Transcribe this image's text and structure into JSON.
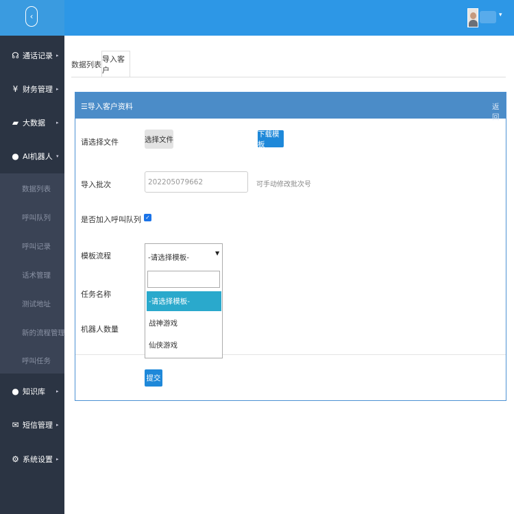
{
  "sidebar": {
    "back_icon": "chevron-left-icon",
    "items": [
      {
        "label": "通话记录",
        "icon": "headset-icon",
        "glyph": "☊"
      },
      {
        "label": "财务管理",
        "icon": "yen-icon",
        "glyph": "¥"
      },
      {
        "label": "大数据",
        "icon": "folder-icon",
        "glyph": "▰"
      },
      {
        "label": "AI机器人",
        "icon": "android-icon",
        "glyph": "●"
      },
      {
        "label": "知识库",
        "icon": "info-icon",
        "glyph": "●"
      },
      {
        "label": "短信管理",
        "icon": "envelope-icon",
        "glyph": "✉"
      },
      {
        "label": "系统设置",
        "icon": "gear-icon",
        "glyph": "⚙"
      }
    ],
    "submenu": [
      "数据列表",
      "呼叫队列",
      "呼叫记录",
      "话术管理",
      "测试地址",
      "新的流程管理",
      "呼叫任务"
    ]
  },
  "header": {
    "user_caret": "▾"
  },
  "tabs": [
    {
      "label": "数据列表"
    },
    {
      "label": "导入客户"
    }
  ],
  "panel": {
    "title": "☰导入客户资料",
    "back_link": "返回"
  },
  "form": {
    "file_label": "请选择文件",
    "choose_file_button": "选择文件",
    "download_template_button": "下载模板",
    "batch_label": "导入批次",
    "batch_value": "202205079662",
    "batch_hint": "可手动修改批次号",
    "queue_label": "是否加入呼叫队列",
    "queue_checked": true,
    "template_label": "模板流程",
    "template_selected": "-请选择模板-",
    "template_options": [
      "-请选择模板-",
      "战神游戏",
      "仙侠游戏"
    ],
    "task_label": "任务名称",
    "robot_label": "机器人数量",
    "submit_button": "提交"
  },
  "colors": {
    "header_bg": "#2d97e6",
    "sidebar_bg": "#2b3443",
    "panel_head_bg": "#4b8cc8",
    "primary_button": "#1e88d9",
    "highlight_option": "#2aa9cc"
  }
}
